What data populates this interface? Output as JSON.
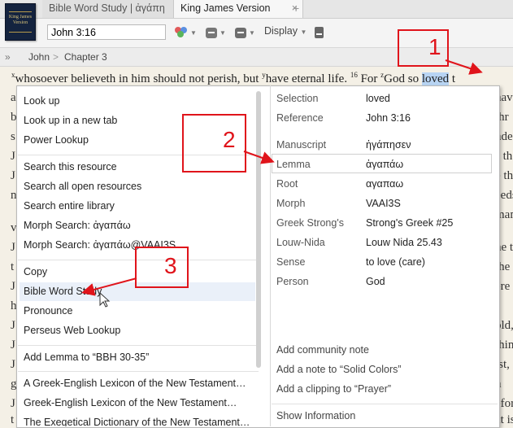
{
  "tabs": {
    "book_cover_text": "King James Version",
    "items": [
      {
        "label": "Bible Word Study | ἀγάπη"
      },
      {
        "label": "King James Version"
      }
    ],
    "close_glyph": "×",
    "new_tab_glyph": "+"
  },
  "toolbar": {
    "reference_value": "John 3:16",
    "display_label": "Display"
  },
  "breadcrumb": {
    "chevron": "»",
    "book": "John",
    "separator": ">",
    "chapter": "Chapter 3"
  },
  "bible_text": {
    "line1": {
      "sup_x": "x",
      "part1": "whosoever believeth in him should not perish, but ",
      "sup_y": "y",
      "part2": "have eternal life. ",
      "verse16": "16",
      "part3": " For ",
      "sup_z": "z",
      "part4": "God so ",
      "selected": "loved",
      "part5": " t"
    },
    "left_margin": [
      "a",
      "b",
      "s",
      "J",
      "J",
      "n",
      "v",
      "J",
      "t",
      "J",
      "h",
      "J",
      "J",
      "J",
      "g",
      "J",
      "t"
    ],
    "right_margin": [
      "have",
      "thr",
      "nde",
      "s th",
      "e the",
      "eeds",
      "mani",
      "he t",
      "the",
      "ere a",
      "old,",
      "thin",
      "ist,",
      "n",
      "efor",
      "at is"
    ]
  },
  "context_menu": {
    "left_groups": [
      [
        "Look up",
        "Look up in a new tab",
        "Power Lookup"
      ],
      [
        "Search this resource",
        "Search all open resources",
        "Search entire library",
        "Morph Search: ἀγαπάω",
        "Morph Search: ἀγαπάω@VAAI3S"
      ],
      [
        "Copy",
        "Bible Word Study",
        "Pronounce",
        "Perseus Web Lookup"
      ],
      [
        "Add Lemma to “BBH 30-35”"
      ],
      [
        "A Greek-English Lexicon of the New Testament…",
        "Greek-English Lexicon of the New Testament…",
        "The Exegetical Dictionary of the New Testament…"
      ]
    ],
    "highlighted_item": "Bible Word Study",
    "word_info": [
      {
        "label": "Selection",
        "value": "loved"
      },
      {
        "label": "Reference",
        "value": "John 3:16"
      },
      {
        "label": "Manuscript",
        "value": "ἠγάπησεν"
      },
      {
        "label": "Lemma",
        "value": "ἀγαπάω"
      },
      {
        "label": "Root",
        "value": "αγαπαω"
      },
      {
        "label": "Morph",
        "value": "VAAI3S"
      },
      {
        "label": "Greek Strong's",
        "value": "Strong's Greek #25"
      },
      {
        "label": "Louw-Nida",
        "value": "Louw Nida 25.43"
      },
      {
        "label": "Sense",
        "value": "to love (care)"
      },
      {
        "label": "Person",
        "value": "God"
      }
    ],
    "right_actions": [
      "Add community note",
      "Add a note to “Solid Colors”",
      "Add a clipping to “Prayer”"
    ],
    "show_information": "Show Information"
  },
  "callouts": [
    "1",
    "2",
    "3"
  ],
  "colors": {
    "callout_red": "#e0141b",
    "selection_blue": "#b8d4f3",
    "menu_highlight": "#eaf0f9"
  }
}
